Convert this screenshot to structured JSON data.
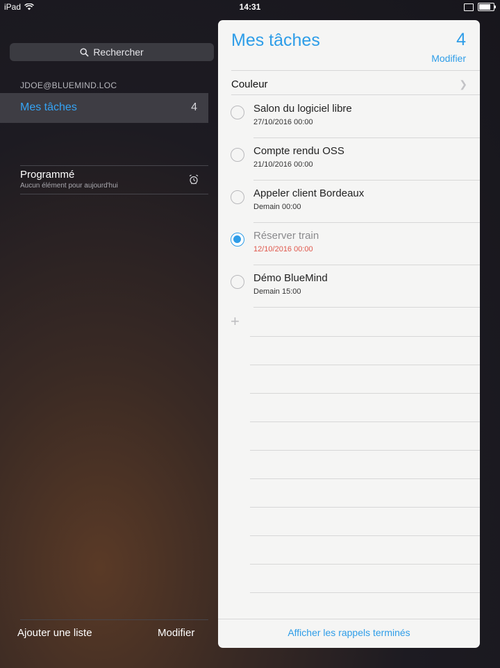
{
  "status_bar": {
    "carrier": "iPad",
    "time": "14:31",
    "battery_level": 0.9
  },
  "sidebar": {
    "search_label": "Rechercher",
    "account": "JDOE@BLUEMIND.LOC",
    "selected_list": {
      "label": "Mes tâches",
      "count": "4"
    },
    "scheduled": {
      "title": "Programmé",
      "subtitle": "Aucun élément pour aujourd'hui"
    },
    "footer": {
      "add_list": "Ajouter une liste",
      "edit": "Modifier"
    }
  },
  "panel": {
    "title": "Mes tâches",
    "count": "4",
    "edit_label": "Modifier",
    "color_label": "Couleur",
    "tasks": [
      {
        "title": "Salon du logiciel libre",
        "date": "27/10/2016 00:00",
        "completed": false
      },
      {
        "title": "Compte rendu OSS",
        "date": "21/10/2016 00:00",
        "completed": false
      },
      {
        "title": "Appeler client Bordeaux",
        "date": "Demain 00:00",
        "completed": false
      },
      {
        "title": "Réserver train",
        "date": "12/10/2016 00:00",
        "completed": true
      },
      {
        "title": "Démo BlueMind",
        "date": "Demain 15:00",
        "completed": false
      }
    ],
    "show_completed": "Afficher les rappels terminés"
  },
  "colors": {
    "accent": "#2e9de8",
    "overdue": "#e0584c"
  }
}
